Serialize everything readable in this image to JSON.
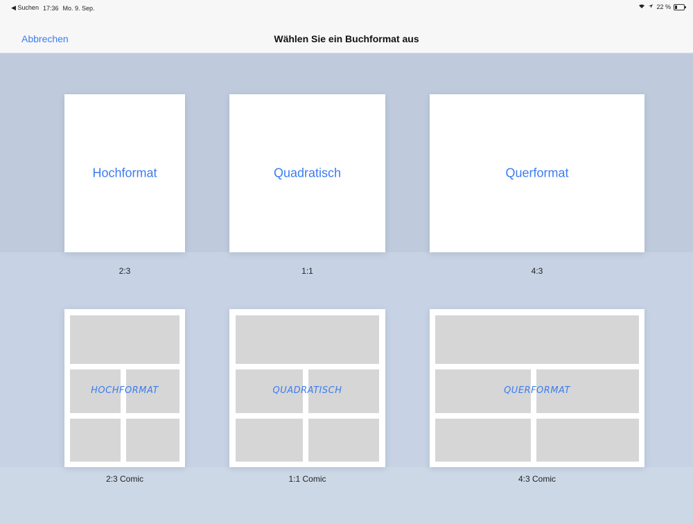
{
  "status": {
    "back": "◀ Suchen",
    "time": "17:36",
    "date": "Mo. 9. Sep.",
    "battery": "22 %",
    "battery_level": 0.22
  },
  "nav": {
    "cancel": "Abbrechen",
    "title": "Wählen Sie ein Buchformat aus"
  },
  "formats": [
    {
      "label": "Hochformat",
      "ratio": "2:3"
    },
    {
      "label": "Quadratisch",
      "ratio": "1:1"
    },
    {
      "label": "Querformat",
      "ratio": "4:3"
    }
  ],
  "comics": [
    {
      "label": "HOCHFORMAT",
      "ratio": "2:3 Comic"
    },
    {
      "label": "QUADRATISCH",
      "ratio": "1:1 Comic"
    },
    {
      "label": "QUERFORMAT",
      "ratio": "4:3 Comic"
    }
  ],
  "colors": {
    "accent": "#3b7cf0",
    "panel": "#d6d6d6"
  }
}
